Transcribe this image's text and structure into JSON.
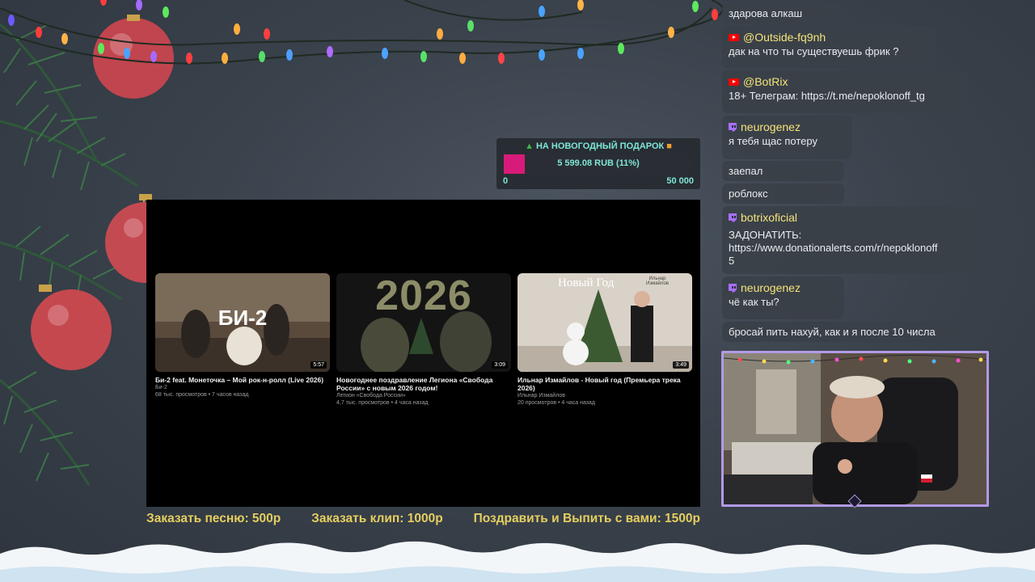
{
  "goal": {
    "title": "НА НОВОГОДНЫЙ ПОДАРОК",
    "tree_icon": "christmas-tree-icon",
    "gift_icon": "gift-icon",
    "raised_label": "5 599.08 RUB (11%)",
    "progress_fraction": 0.11,
    "min_label": "0",
    "max_label": "50 000",
    "fill_color": "#d81b7a",
    "text_color": "#7fe6d8"
  },
  "player": {
    "videos": [
      {
        "title": "Би-2 feat. Монеточка – Мой рок-н-ролл (Live 2026)",
        "channel": "Би-2",
        "meta": "68 тыс. просмотров • 7 часов назад",
        "duration": "5:57",
        "thumb_text": "БИ-2"
      },
      {
        "title": "Новогоднее поздравление Легиона «Свобода России» с новым 2026 годом!",
        "channel": "Легион «Свобода России»",
        "meta": "4,7 тыс. просмотров • 4 часа назад",
        "duration": "3:09",
        "thumb_text": "2026"
      },
      {
        "title": "Ильнар Измайлов - Новый год (Премьера трека 2026)",
        "channel": "Ильнар Измайлов",
        "meta": "20 просмотров • 4 часа назад",
        "duration": "3:49",
        "thumb_text": "Новый Год",
        "thumb_subtext": "Ильнар Измайлов"
      }
    ]
  },
  "prices": {
    "song": "Заказать песню: 500р",
    "clip": "Заказать клип: 1000р",
    "congrats": "Поздравить и Выпить с вами: 1500р"
  },
  "chat": [
    {
      "platform": "youtube",
      "user": "",
      "text": "здарова алкаш"
    },
    {
      "platform": "youtube",
      "user": "@Outside-fq9nh",
      "text": "дак на что ты существуешь фрик ?"
    },
    {
      "platform": "youtube",
      "user": "@BotRix",
      "text": "18+ Телеграм: https://t.me/nepoklonoff_tg"
    },
    {
      "platform": "twitch",
      "user": "neurogenez",
      "text": "я тебя щас потеру"
    },
    {
      "platform": "twitch",
      "user": "",
      "text": "заепал"
    },
    {
      "platform": "twitch",
      "user": "",
      "text": "роблокс"
    },
    {
      "platform": "twitch",
      "user": "botrixoficial",
      "text": "ЗАДОНАТИТЬ:",
      "text2": "https://www.donationalerts.com/r/nepoklonoff",
      "text3": "5"
    },
    {
      "platform": "twitch",
      "user": "neurogenez",
      "text": "чё как ты?"
    },
    {
      "platform": "twitch",
      "user": "",
      "text": "бросай пить нахуй, как и я после 10 числа"
    }
  ]
}
